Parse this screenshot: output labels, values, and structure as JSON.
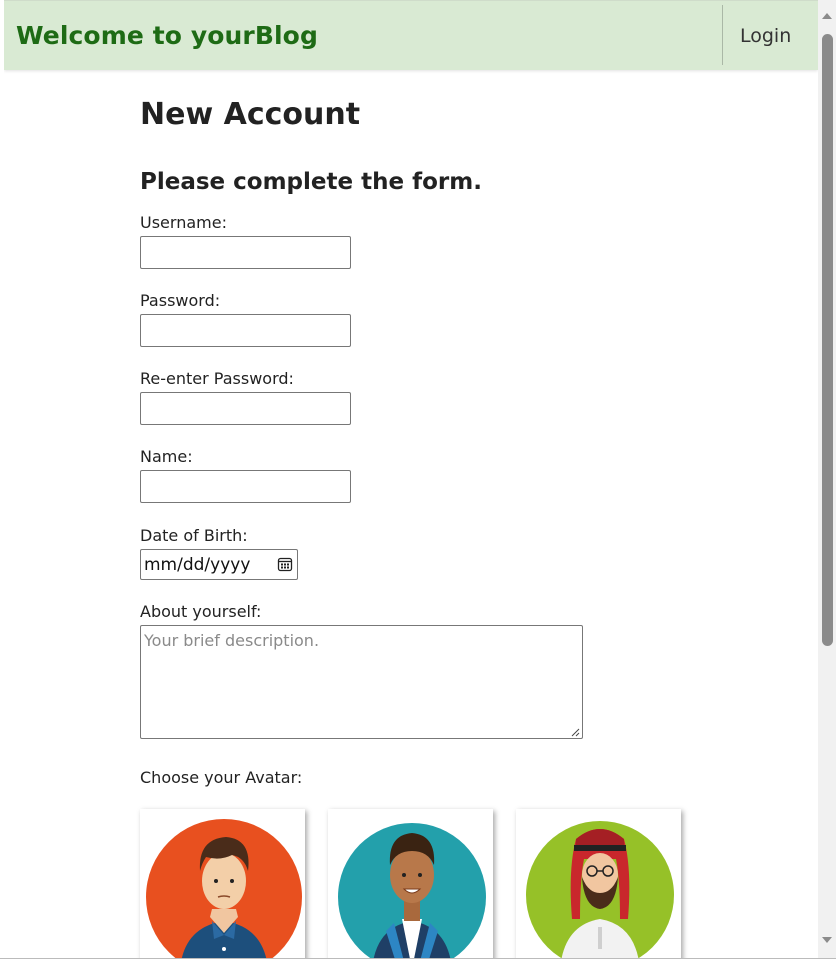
{
  "navbar": {
    "brand": "Welcome to yourBlog",
    "login": "Login",
    "background_color": "#d9ead3",
    "brand_color": "#1e6b15"
  },
  "page": {
    "title": "New Account",
    "form_heading": "Please complete the form."
  },
  "form": {
    "username_label": "Username:",
    "password_label": "Password:",
    "reenter_label": "Re-enter Password:",
    "name_label": "Name:",
    "dob_label": "Date of Birth:",
    "dob_placeholder": "mm/dd/yyyy",
    "about_label": "About yourself:",
    "about_placeholder": "Your brief description.",
    "avatar_label": "Choose your Avatar:"
  },
  "avatars": [
    {
      "name": "avatar-option-1",
      "background_color": "#e8501f"
    },
    {
      "name": "avatar-option-2",
      "background_color": "#23a0ab"
    },
    {
      "name": "avatar-option-3",
      "background_color": "#96c128"
    }
  ],
  "icons": {
    "calendar": "calendar-icon",
    "scroll_up": "chevron-up-icon",
    "scroll_down": "chevron-down-icon"
  }
}
